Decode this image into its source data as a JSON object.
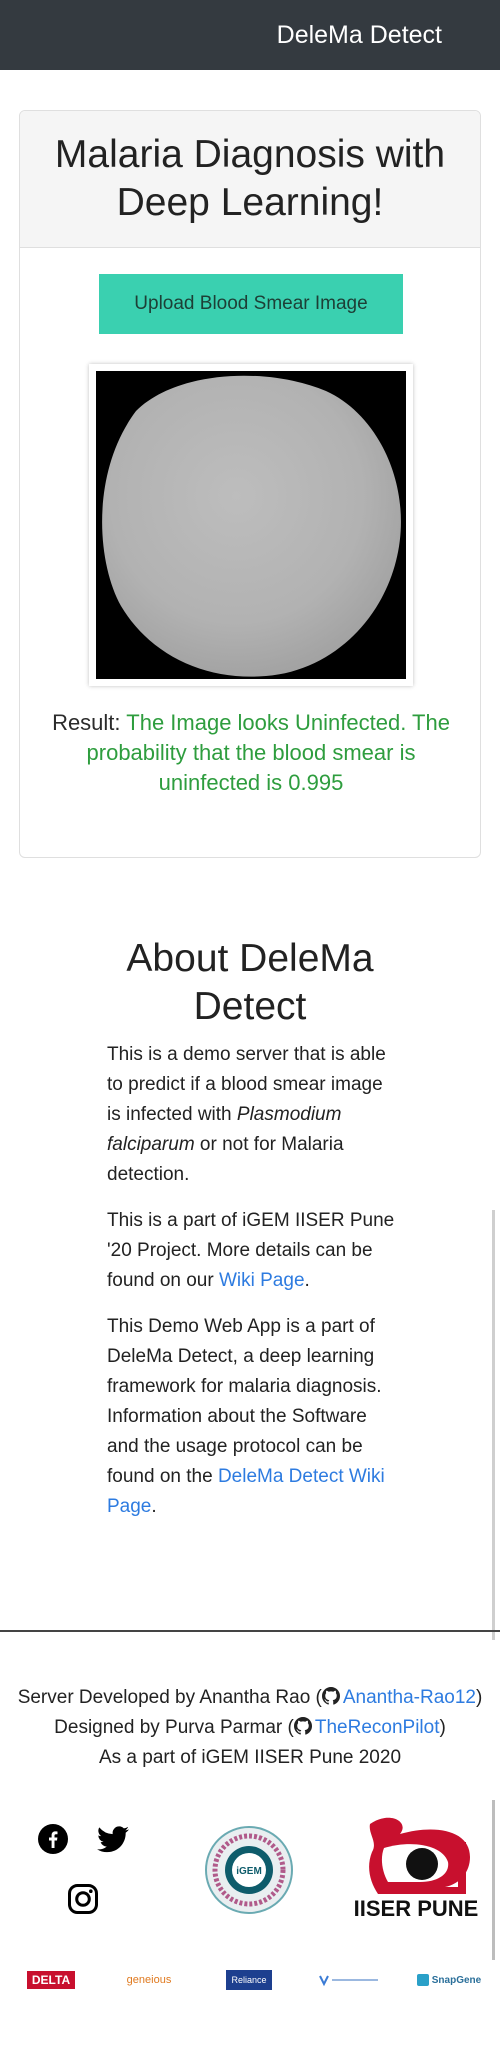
{
  "navbar": {
    "brand": "DeleMa Detect"
  },
  "card": {
    "title": "Malaria Diagnosis with Deep Learning!",
    "upload_label": "Upload Blood Smear Image",
    "result_label": "Result:",
    "result_text": "The Image looks Uninfected. The probability that the blood smear is uninfected is 0.995"
  },
  "about": {
    "title": "About DeleMa Detect",
    "p1_before": "This is a demo server that is able to predict if a blood smear image is infected with ",
    "p1_italic": "Plasmodium falciparum",
    "p1_after": " or not for Malaria detection.",
    "p2_before": "This is a part of iGEM IISER Pune '20 Project. More details can be found on our ",
    "p2_link": "Wiki Page",
    "p2_after": ".",
    "p3_before": "This Demo Web App is a part of DeleMa Detect, a deep learning framework for malaria diagnosis. Information about the Software and the usage protocol can be found on the ",
    "p3_link": "DeleMa Detect Wiki Page",
    "p3_after": "."
  },
  "footer": {
    "line1_before": "Server Developed by Anantha Rao (",
    "line1_link": "Anantha-Rao12",
    "line1_after": ")",
    "line2_before": "Designed by Purva Parmar (",
    "line2_link": "TheReconPilot",
    "line2_after": ")",
    "line3": "As a part of iGEM IISER Pune 2020",
    "social_icons": [
      "facebook-icon",
      "twitter-icon",
      "instagram-icon"
    ],
    "igem_badge_text": "iGEM",
    "iiser_logo_text": "IISER PUNE",
    "sponsors": [
      "DELTA",
      "geneious",
      "Reliance",
      "SnapGene"
    ]
  },
  "colors": {
    "navbar": "#343a40",
    "upload_button": "#3ad0b0",
    "success_text": "#2e9d3e",
    "link": "#2d7be0",
    "iiser_red": "#c8102e"
  }
}
